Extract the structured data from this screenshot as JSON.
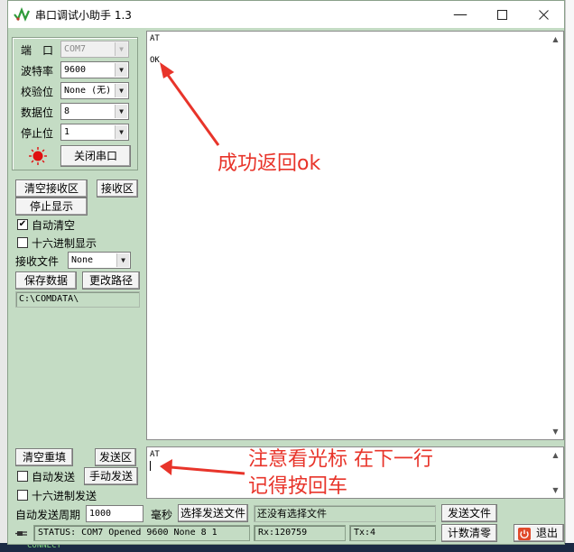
{
  "window": {
    "title": "串口调试小助手 1.3"
  },
  "config": {
    "port_label": "端　口",
    "port_value": "COM7",
    "baud_label": "波特率",
    "baud_value": "9600",
    "parity_label": "校验位",
    "parity_value": "None (无)",
    "databits_label": "数据位",
    "databits_value": "8",
    "stopbits_label": "停止位",
    "stopbits_value": "1",
    "close_port_label": "关闭串口",
    "indicator_color": "#e01010"
  },
  "receive_controls": {
    "clear_receive_label": "清空接收区",
    "receive_area_label": "接收区",
    "stop_display_label": "停止显示",
    "auto_clear_label": "自动清空",
    "auto_clear_checked": "✔",
    "hex_display_label": "十六进制显示",
    "receive_file_label": "接收文件",
    "receive_file_value": "None",
    "save_data_label": "保存数据",
    "change_path_label": "更改路径",
    "path_value": "C:\\COMDATA\\"
  },
  "receive_text": {
    "line1": "AT",
    "line2": "OK"
  },
  "send_controls": {
    "clear_resend_label": "清空重填",
    "send_area_label": "发送区",
    "auto_send_label": "自动发送",
    "manual_send_label": "手动发送",
    "hex_send_label": "十六进制发送",
    "period_label": "自动发送周期",
    "period_value": "1000",
    "ms_label": "毫秒",
    "select_file_label": "选择发送文件",
    "no_file_text": "还没有选择文件",
    "send_file_label": "发送文件",
    "count_clear_label": "计数清零",
    "exit_label": "退出"
  },
  "send_text": {
    "line1": "AT"
  },
  "status": {
    "status_text": "STATUS: COM7 Opened 9600 None  8 1",
    "rx_text": "Rx:120759",
    "tx_text": "Tx:4"
  },
  "annotations": {
    "success_text": "成功返回ok",
    "cursor_note_line1": "注意看光标 在下一行",
    "cursor_note_line2": "记得按回车",
    "color": "#e8342a"
  },
  "background": {
    "console_text": "CONNECT"
  }
}
